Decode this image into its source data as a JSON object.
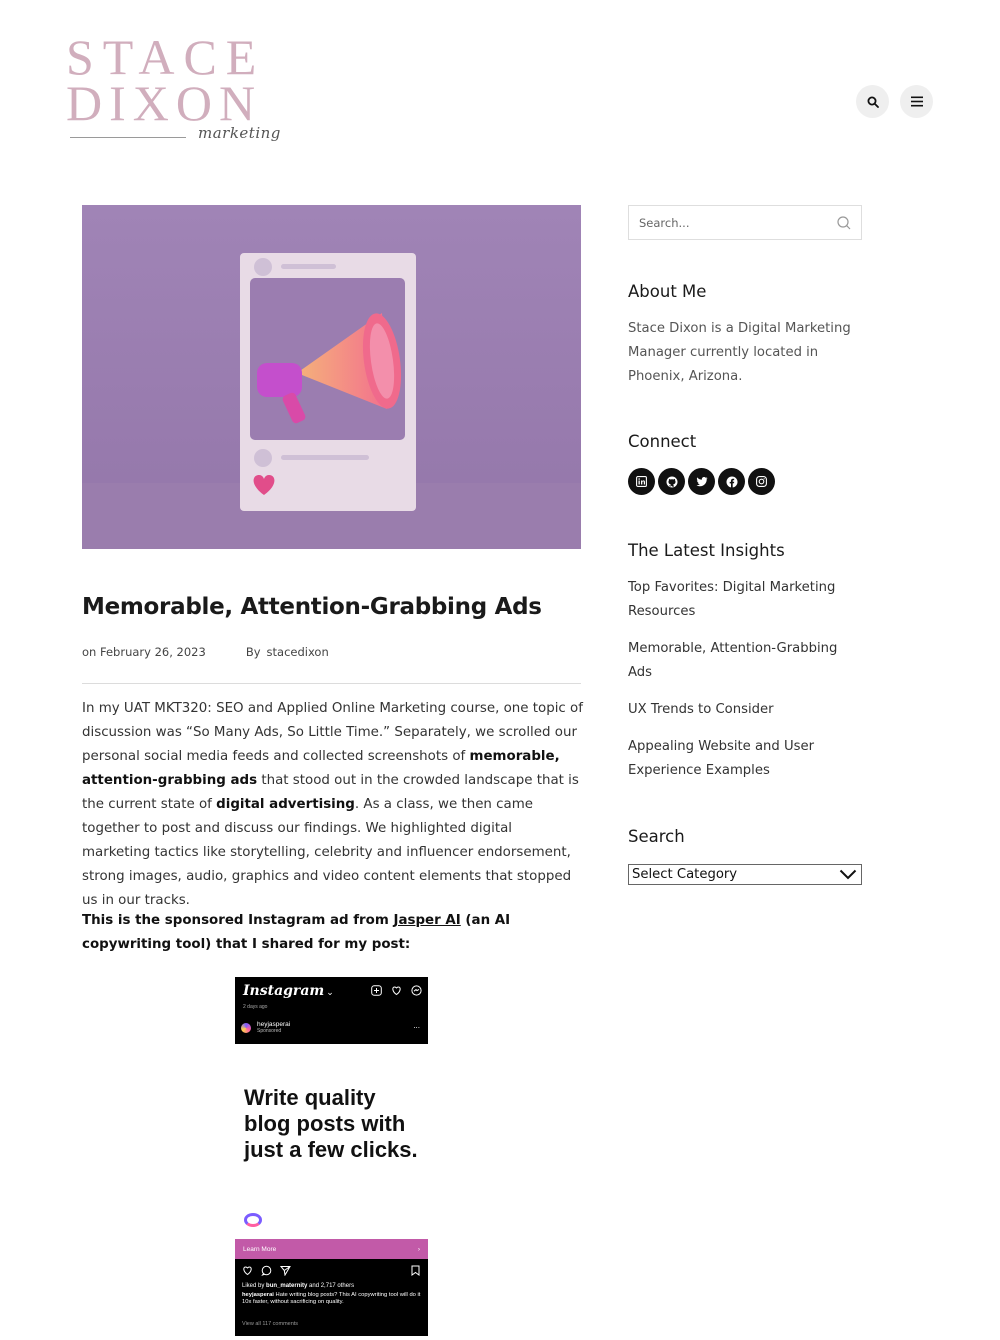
{
  "site": {
    "logo_line1": "STACE",
    "logo_line2": "DIXON",
    "logo_script": "marketing"
  },
  "header": {
    "search_icon": "search-icon",
    "menu_icon": "menu-icon"
  },
  "post": {
    "title": "Memorable, Attention-Grabbing Ads",
    "date": "on February 26, 2023",
    "by_label": "By",
    "author": "stacedixon",
    "body": {
      "p1_a": "In my UAT MKT320: SEO and Applied Online Marketing course, one topic of discussion was “So Many Ads, So Little Time.” Separately, we scrolled our personal social media feeds and collected screenshots of ",
      "p1_b": "memorable, attention-grabbing ads",
      "p1_c": " that stood out in the crowded landscape that is the current state of ",
      "p1_d": "digital advertising",
      "p1_e": ". As a class, we then came together to post and discuss our findings. We highlighted digital marketing tactics like storytelling, celebrity and influencer endorsement, strong images, audio, graphics and video content elements that stopped us in our tracks."
    },
    "lead": {
      "before": "This is the sponsored Instagram ad from ",
      "link": "Jasper AI",
      "after": " (an AI copywriting tool) that I shared for my post:"
    }
  },
  "instagram_ad": {
    "brand": "Instagram",
    "time_ago": "2 days ago",
    "username": "heyjasperai",
    "sponsored": "Sponsored",
    "more": "...",
    "headline": "Write quality blog posts with just a few clicks.",
    "cta": "Learn More",
    "liked_by_prefix": "Liked by",
    "liked_by_user": "bun_maternity",
    "liked_by_suffix": "and 2,717 others",
    "caption_user": "heyjasperai",
    "caption": "Hate writing blog posts? This AI copywriting tool will do it 10x faster, without sacrificing on quality.",
    "view_all": "View all 117 comments"
  },
  "sidebar": {
    "search_placeholder": "Search...",
    "about_heading": "About Me",
    "about_text": "Stace Dixon is a Digital Marketing Manager currently located in Phoenix, Arizona.",
    "connect_heading": "Connect",
    "social": [
      "linkedin-icon",
      "github-icon",
      "twitter-icon",
      "facebook-icon",
      "instagram-icon"
    ],
    "insights_heading": "The Latest Insights",
    "insights": [
      "Top Favorites: Digital Marketing Resources",
      "Memorable, Attention-Grabbing Ads",
      "UX Trends to Consider",
      "Appealing Website and User Experience Examples"
    ],
    "search_heading": "Search",
    "category_select": "Select Category"
  },
  "colors": {
    "logo_pink": "#d1aebd",
    "hero_bg": "#9c7db0",
    "cta_pink": "#c25aa8"
  }
}
